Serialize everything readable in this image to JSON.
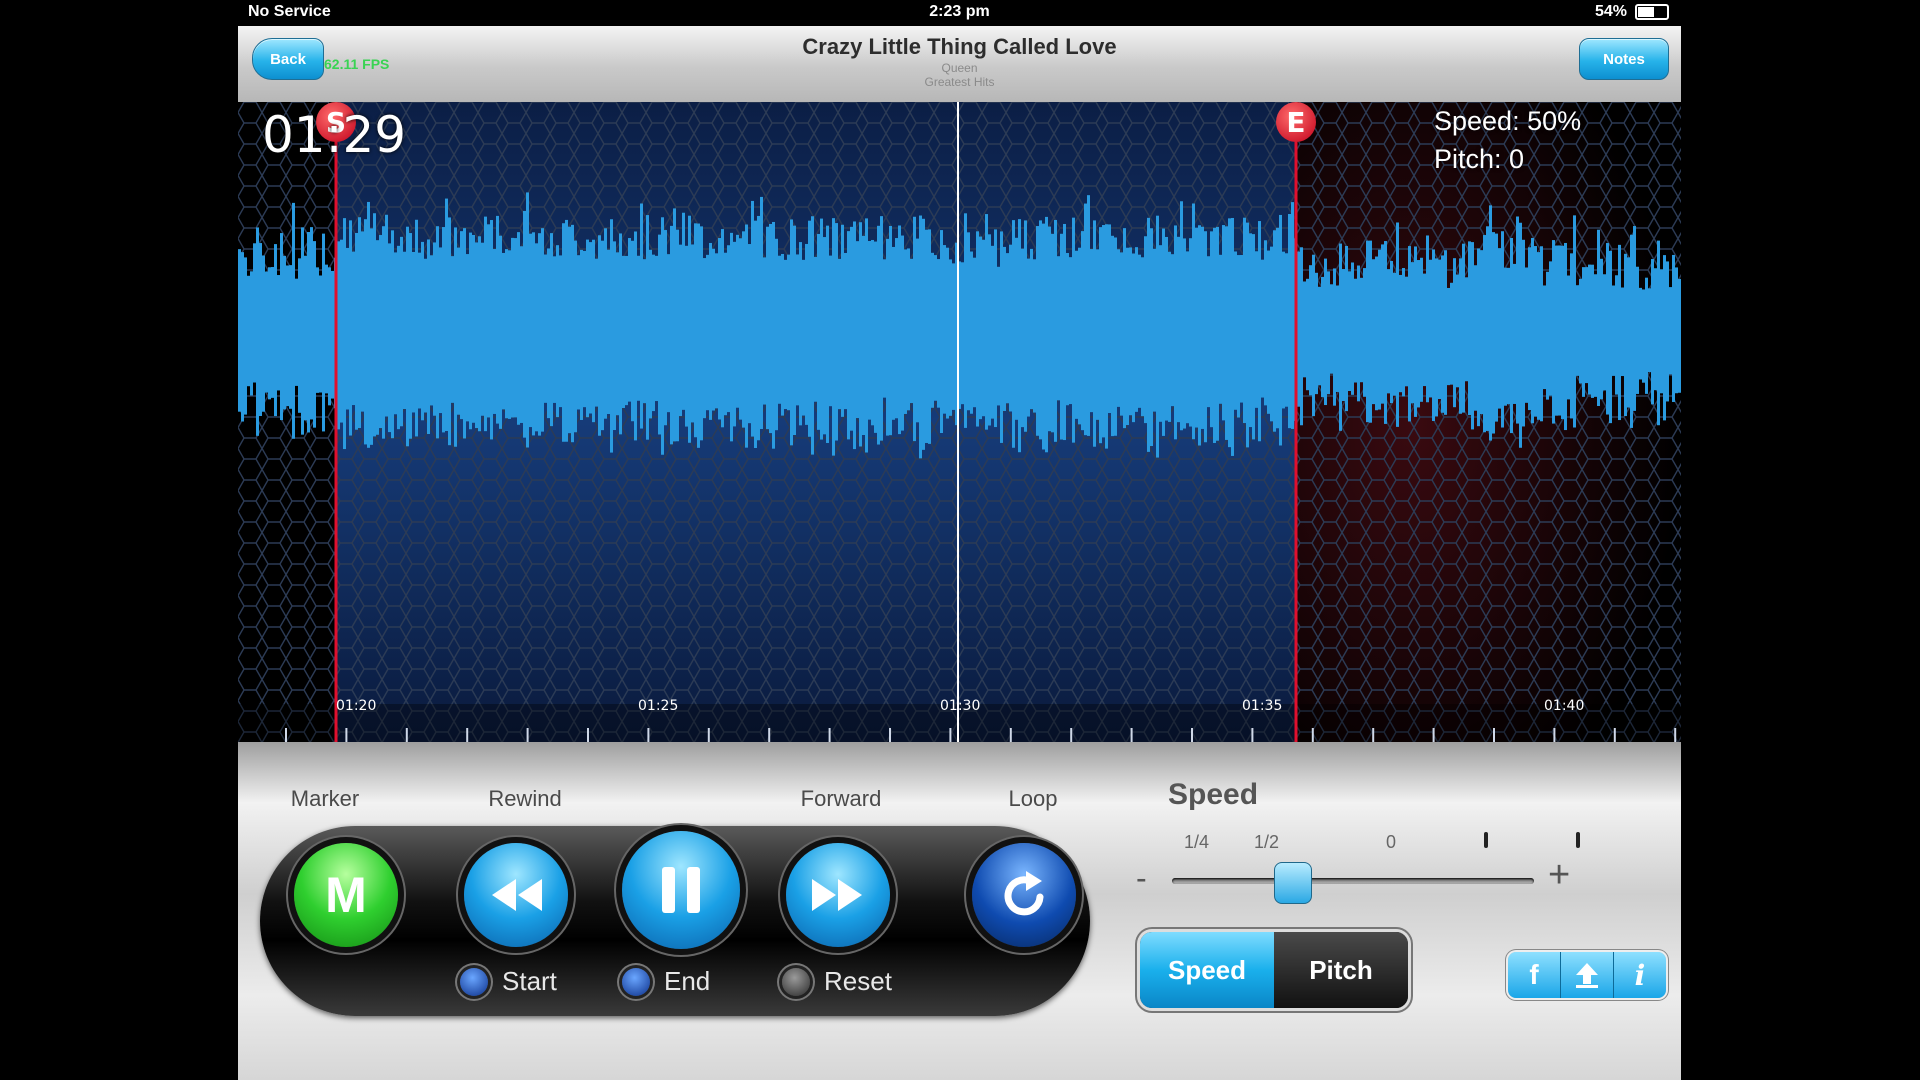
{
  "status_bar": {
    "carrier": "No Service",
    "time": "2:23 pm",
    "battery": "54%"
  },
  "nav": {
    "back_label": "Back",
    "fps": "62.11 FPS",
    "notes_label": "Notes",
    "title": "Crazy Little Thing Called Love",
    "artist": "Queen",
    "album": "Greatest Hits"
  },
  "waveform": {
    "current_time": "01:29",
    "speed_text": "Speed: 50%",
    "pitch_text": "Pitch: 0",
    "start_marker": "S",
    "end_marker": "E",
    "timeline_ticks": [
      "01:20",
      "01:25",
      "01:30",
      "01:35",
      "01:40"
    ],
    "colors": {
      "wave": "#2a9be0",
      "marker": "#e0102e",
      "playhead": "#ffffff"
    }
  },
  "controls": {
    "marker_label": "Marker",
    "marker_button": "M",
    "rewind_label": "Rewind",
    "forward_label": "Forward",
    "loop_label": "Loop",
    "start_label": "Start",
    "end_label": "End",
    "reset_label": "Reset"
  },
  "speed_panel": {
    "title": "Speed",
    "ticks": [
      "1/4",
      "1/2",
      "0"
    ],
    "minus": "-",
    "plus": "+",
    "segment_speed": "Speed",
    "segment_pitch": "Pitch",
    "selected_segment": "Speed",
    "share_icons": [
      "facebook-icon",
      "share-icon",
      "info-icon"
    ],
    "share_facebook": "f",
    "share_info": "i"
  }
}
